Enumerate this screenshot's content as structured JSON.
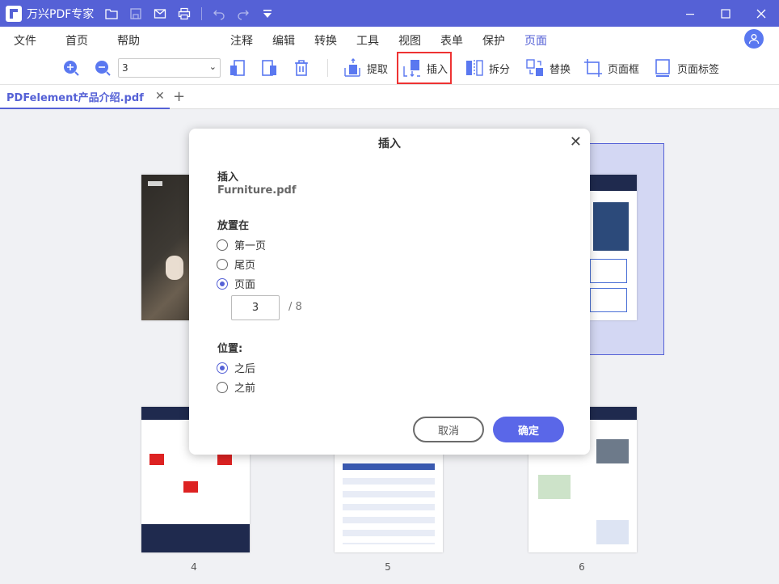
{
  "titlebar": {
    "app_name": "万兴PDF专家"
  },
  "menu": {
    "items": [
      "文件",
      "首页",
      "帮助",
      "注释",
      "编辑",
      "转换",
      "工具",
      "视图",
      "表单",
      "保护",
      "页面"
    ],
    "active": "页面"
  },
  "toolbar": {
    "page_select_value": "3",
    "buttons": {
      "extract": "提取",
      "insert": "插入",
      "split": "拆分",
      "replace": "替换",
      "page_box": "页面框",
      "page_label": "页面标签"
    }
  },
  "tabs": {
    "doc_name": "PDFelement产品介绍.pdf",
    "add": "+"
  },
  "pages": {
    "numbers": [
      "4",
      "5",
      "6"
    ]
  },
  "dialog": {
    "title": "插入",
    "insert_label": "插入",
    "file_name": "Furniture.pdf",
    "place_label": "放置在",
    "place_options": [
      "第一页",
      "尾页",
      "页面"
    ],
    "place_selected": "页面",
    "page_value": "3",
    "page_total": "/ 8",
    "position_label": "位置:",
    "position_options": [
      "之后",
      "之前"
    ],
    "position_selected": "之后",
    "cancel": "取消",
    "ok": "确定"
  },
  "colors": {
    "brand": "#5561d6",
    "highlight": "#ee3333",
    "ok_button": "#5a67e8"
  }
}
